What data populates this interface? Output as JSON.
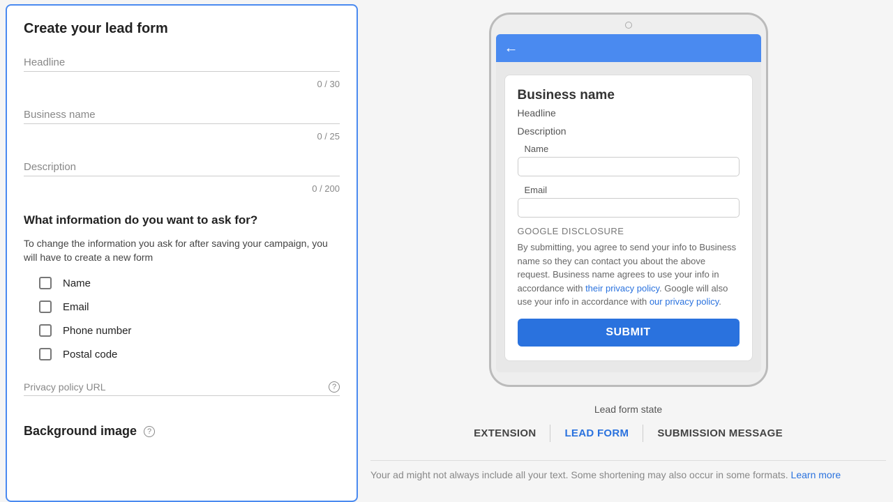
{
  "left": {
    "title": "Create your lead form",
    "headline": {
      "label": "Headline",
      "count": "0 / 30"
    },
    "business": {
      "label": "Business name",
      "count": "0 / 25"
    },
    "description": {
      "label": "Description",
      "count": "0 / 200"
    },
    "ask_heading": "What information do you want to ask for?",
    "ask_hint": "To change the information you ask for after saving your campaign, you will have to create a new form",
    "checks": {
      "name": "Name",
      "email": "Email",
      "phone": "Phone number",
      "postal": "Postal code"
    },
    "privacy_label": "Privacy policy URL",
    "bg_image_label": "Background image"
  },
  "preview": {
    "business": "Business name",
    "headline": "Headline",
    "description": "Description",
    "name_label": "Name",
    "email_label": "Email",
    "disclosure_title": "GOOGLE DISCLOSURE",
    "disclosure_1": "By submitting, you agree to send your info to Business name so they can contact you about the above request. Business name agrees to use your info in accordance with ",
    "disclosure_link1": "their privacy policy",
    "disclosure_2": ". Google will also use your info in accordance with ",
    "disclosure_link2": "our privacy policy",
    "disclosure_3": ".",
    "submit": "SUBMIT"
  },
  "state": {
    "label": "Lead form state",
    "tabs": {
      "extension": "EXTENSION",
      "leadform": "LEAD FORM",
      "submission": "SUBMISSION MESSAGE"
    }
  },
  "footer": {
    "text": "Your ad might not always include all your text. Some shortening may also occur in some formats. ",
    "link": "Learn more"
  }
}
